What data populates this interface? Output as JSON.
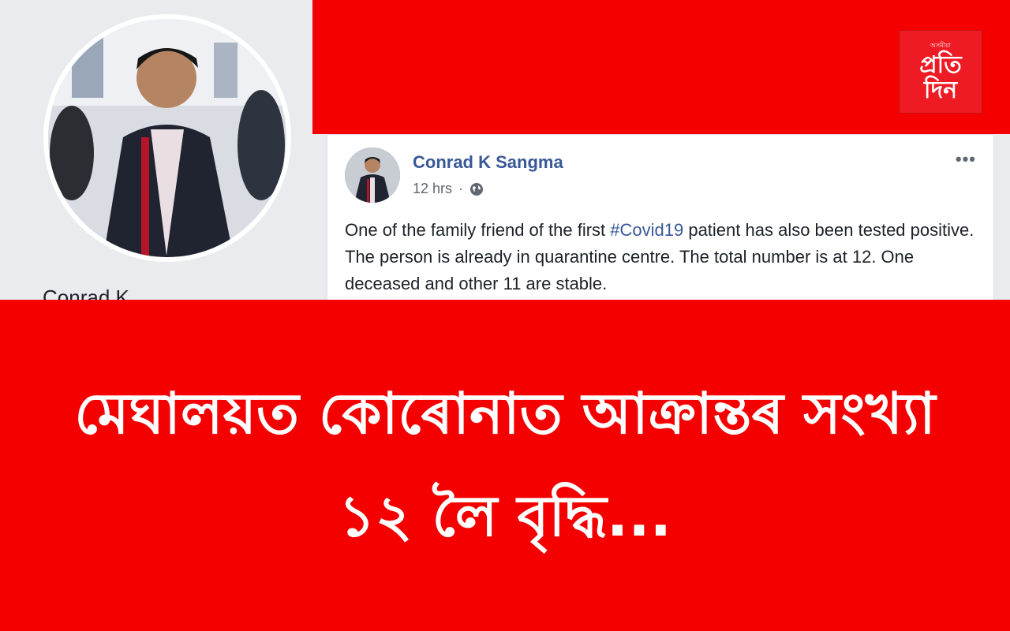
{
  "profile": {
    "name_partial": "Conrad K"
  },
  "brand": {
    "tagline": "অসমীয়া",
    "word1": "প্ৰতি",
    "word2": "দিন"
  },
  "post": {
    "author": "Conrad K Sangma",
    "time": "12 hrs",
    "separator": "·",
    "more": "•••",
    "text_before": "One of the family friend of the first ",
    "hashtag": "#Covid19",
    "text_after": " patient has also been tested positive. The person is already in quarantine centre. The total number is at 12. One deceased and other 11 are stable."
  },
  "headline": {
    "line1": "মেঘালয়ত কোৰোনাত আক্ৰান্তৰ সংখ্যা",
    "line2": "১২ লৈ বৃদ্ধি..."
  },
  "colors": {
    "band_red": "#f40000",
    "link_blue": "#385898"
  },
  "icons": {
    "privacy": "globe-icon",
    "menu": "more-icon"
  }
}
